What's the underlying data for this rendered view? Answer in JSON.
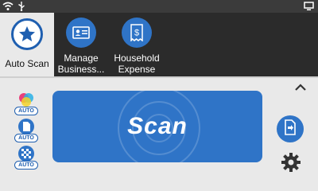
{
  "profiles": [
    {
      "label": "Auto Scan"
    },
    {
      "label_line1": "Manage",
      "label_line2": "Business..."
    },
    {
      "label_line1": "Household",
      "label_line2": "Expense"
    }
  ],
  "settings": {
    "color_mode_badge": "AUTO",
    "paper_size_badge": "AUTO",
    "resolution_badge": "AUTO"
  },
  "scan_button": {
    "label": "Scan"
  },
  "colors": {
    "accent": "#2f74c7",
    "dark_panel": "#2b2b2b",
    "status_bar": "#3b3b3b"
  },
  "icons": [
    "wifi-icon",
    "usb-icon",
    "monitor-icon",
    "star-icon",
    "id-card-icon",
    "receipt-icon",
    "color-mode-icon",
    "paper-size-icon",
    "resolution-icon",
    "chevron-up-icon",
    "scan-side-icon",
    "gear-icon"
  ]
}
